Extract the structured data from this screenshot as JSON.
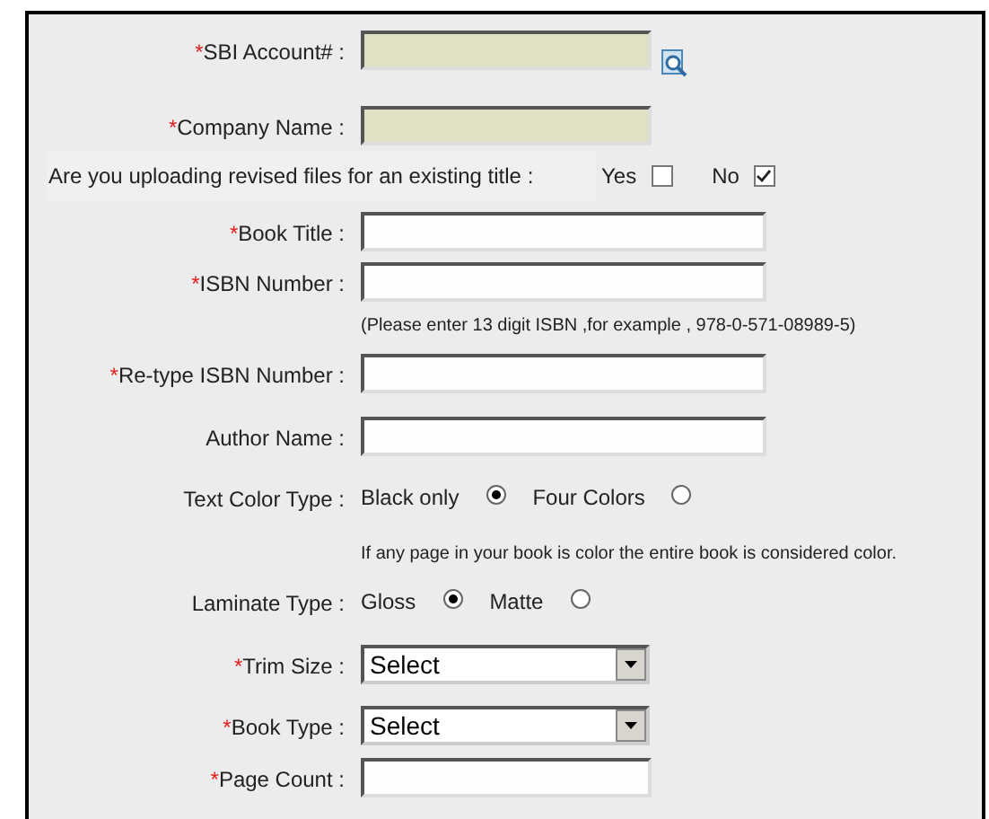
{
  "rows": [
    {
      "kind": "short_text",
      "marker": "*",
      "label": "SBI Account# :",
      "prefilled": true,
      "lookup": true
    },
    {
      "kind": "short_text",
      "marker": "*",
      "label": "Company Name :",
      "prefilled": true
    },
    {
      "kind": "question",
      "label": "Are you uploading revised files for an existing title :",
      "options": [
        {
          "label": "Yes",
          "checked": false
        },
        {
          "label": "No",
          "checked": true
        }
      ]
    },
    {
      "kind": "long_text",
      "marker": "*",
      "label": "Book Title :"
    },
    {
      "kind": "long_text",
      "marker": "*",
      "label": "ISBN Number :",
      "hint": "(Please enter 13 digit ISBN ,for example , 978-0-571-08989-5)"
    },
    {
      "kind": "long_text",
      "marker": "*",
      "label": "Re-type ISBN Number :"
    },
    {
      "kind": "long_text",
      "label": "Author Name :"
    },
    {
      "kind": "radio",
      "label": "Text Color Type :",
      "options": [
        {
          "label": "Black only",
          "selected": true
        },
        {
          "label": "Four Colors",
          "selected": false
        }
      ],
      "hint": "If any page in your book is color the entire book is considered color."
    },
    {
      "kind": "radio",
      "label": "Laminate Type :",
      "options": [
        {
          "label": "Gloss",
          "selected": true
        },
        {
          "label": "Matte",
          "selected": false
        }
      ]
    },
    {
      "kind": "select",
      "marker": "*",
      "label": "Trim Size :",
      "value": "Select"
    },
    {
      "kind": "select",
      "marker": "*",
      "label": "Book Type :",
      "value": "Select"
    },
    {
      "kind": "short_text",
      "marker": "*",
      "label": "Page Count :"
    }
  ]
}
